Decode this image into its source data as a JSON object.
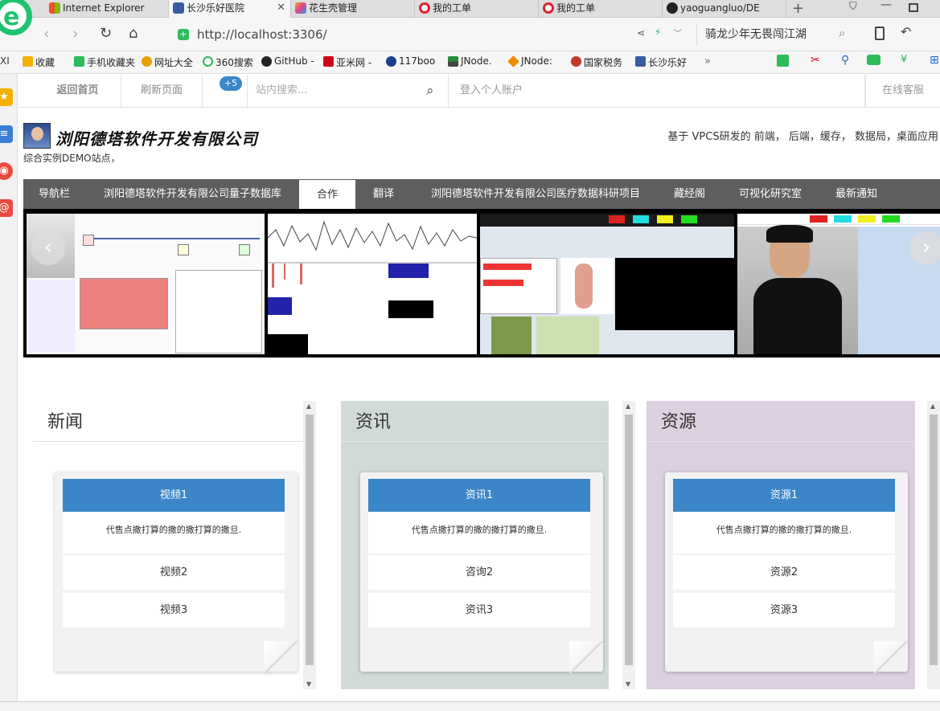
{
  "browser": {
    "tabs": [
      {
        "title": "Internet Explorer",
        "icon": "windows-icon",
        "color": "#f25022"
      },
      {
        "title": "长沙乐好医院",
        "icon": "person-avatar-icon",
        "color": "#3a5ba0"
      },
      {
        "title": "花生壳管理",
        "icon": "peanut-shell-icon",
        "color": "#f0a020"
      },
      {
        "title": "我的工单",
        "icon": "opera-icon",
        "color": "#e0202e"
      },
      {
        "title": "我的工单",
        "icon": "opera-icon",
        "color": "#e0202e"
      },
      {
        "title": "yaoguangluo/DE",
        "icon": "github-icon",
        "color": "#222222"
      }
    ],
    "new_tab_label": "+",
    "address": "http://localhost:3306/",
    "search_text": "骑龙少年无畏闯江湖",
    "bookmarks": [
      {
        "label": "收藏",
        "icon": "star-icon",
        "color": "#f3b000"
      },
      {
        "label": "手机收藏夹",
        "icon": "phone-icon",
        "color": "#2dbb5c"
      },
      {
        "label": "网址大全",
        "icon": "globe-icon",
        "color": "#e8a000"
      },
      {
        "label": "360搜索",
        "icon": "360-icon",
        "color": "#2dbb5c"
      },
      {
        "label": "GitHub -",
        "icon": "github-icon",
        "color": "#222222"
      },
      {
        "label": "亚米网 -",
        "icon": "yami-icon",
        "color": "#d0021b"
      },
      {
        "label": "117boo",
        "icon": "circle-icon",
        "color": "#1d3c8f"
      },
      {
        "label": "JNode.",
        "icon": "jnode-icon",
        "color": "#444444"
      },
      {
        "label": "JNode:",
        "icon": "jnode-diamond-icon",
        "color": "#f08c00"
      },
      {
        "label": "国家税务",
        "icon": "tax-emblem-icon",
        "color": "#c0392b"
      },
      {
        "label": "长沙乐好",
        "icon": "person-avatar-icon",
        "color": "#3a5ba0"
      }
    ],
    "bookmarks_more": "»",
    "bookmarks_left": "XI"
  },
  "site": {
    "topnav": {
      "home": "返回首页",
      "refresh": "刷新页面",
      "badge": "+5",
      "search_placeholder": "站内搜索...",
      "login": "登入个人账户",
      "support": "在线客服"
    },
    "company_name": "浏阳德塔软件开发有限公司",
    "tagline": "基于 VPCS研发的 前端， 后端，缓存， 数据局，桌面应用",
    "subtitle": "综合实例DEMO站点，",
    "menu": [
      "导航栏",
      "浏阳德塔软件开发有限公司量子数据库",
      "合作",
      "翻译",
      "浏阳德塔软件开发有限公司医疗数据科研项目",
      "藏经阁",
      "可视化研究室",
      "最新通知"
    ],
    "menu_active": "合作",
    "carousel": {
      "prev": "‹",
      "next": "›"
    },
    "panels": [
      {
        "title": "新闻",
        "bg": "#ffffff",
        "card": {
          "head": "视频1",
          "desc": "代售点撒打算的撒的撒打算的撒旦.",
          "rows": [
            "视频2",
            "视频3"
          ]
        }
      },
      {
        "title": "资讯",
        "bg": "#d2dad9",
        "card": {
          "head": "资讯1",
          "desc": "代售点撒打算的撒的撒打算的撒旦.",
          "rows": [
            "咨询2",
            "资讯3"
          ]
        }
      },
      {
        "title": "资源",
        "bg": "#dccfdf",
        "card": {
          "head": "资源1",
          "desc": "代售点撒打算的撒的撒打算的撒旦.",
          "rows": [
            "资源2",
            "资源3"
          ]
        }
      }
    ]
  }
}
